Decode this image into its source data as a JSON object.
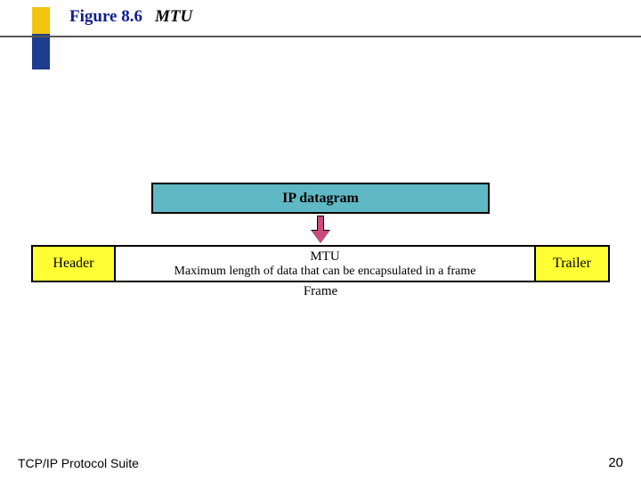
{
  "title": {
    "figure": "Figure 8.6",
    "topic": "MTU"
  },
  "diagram": {
    "ip_datagram": "IP datagram",
    "header": "Header",
    "mtu_label": "MTU",
    "mtu_desc": "Maximum length of data that can be encapsulated in a frame",
    "trailer": "Trailer",
    "frame_caption": "Frame"
  },
  "footer": {
    "left": "TCP/IP Protocol Suite",
    "page": "20"
  }
}
